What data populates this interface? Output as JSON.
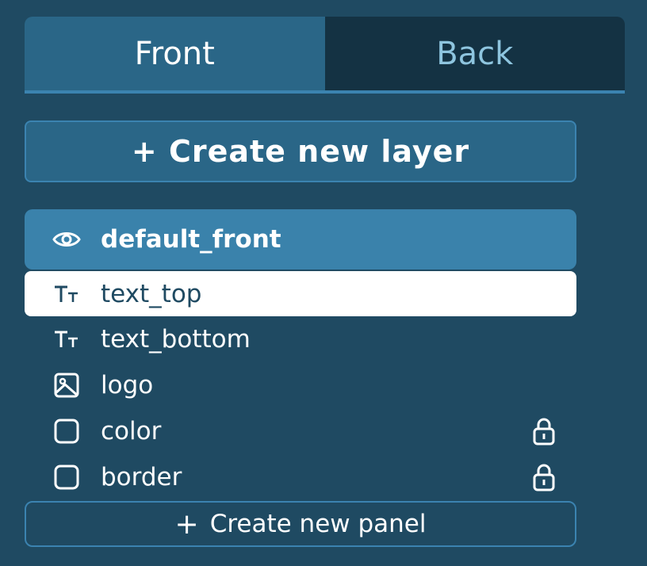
{
  "tabs": {
    "front_label": "Front",
    "back_label": "Back"
  },
  "create_layer_label": "+ Create new layer",
  "layers": {
    "group": {
      "label": "default_front",
      "icon": "eye-icon"
    },
    "items": [
      {
        "label": "text_top",
        "icon": "text-icon",
        "selected": true,
        "locked": false
      },
      {
        "label": "text_bottom",
        "icon": "text-icon",
        "selected": false,
        "locked": false
      },
      {
        "label": "logo",
        "icon": "image-icon",
        "selected": false,
        "locked": false
      },
      {
        "label": "color",
        "icon": "square-icon",
        "selected": false,
        "locked": true
      },
      {
        "label": "border",
        "icon": "square-icon",
        "selected": false,
        "locked": true
      }
    ]
  },
  "create_panel": {
    "plus": "+",
    "label": "Create new panel"
  },
  "colors": {
    "background": "#1f4a62",
    "accent": "#3a82ab",
    "tab_active": "#2a6687",
    "tab_inactive": "#143243"
  }
}
